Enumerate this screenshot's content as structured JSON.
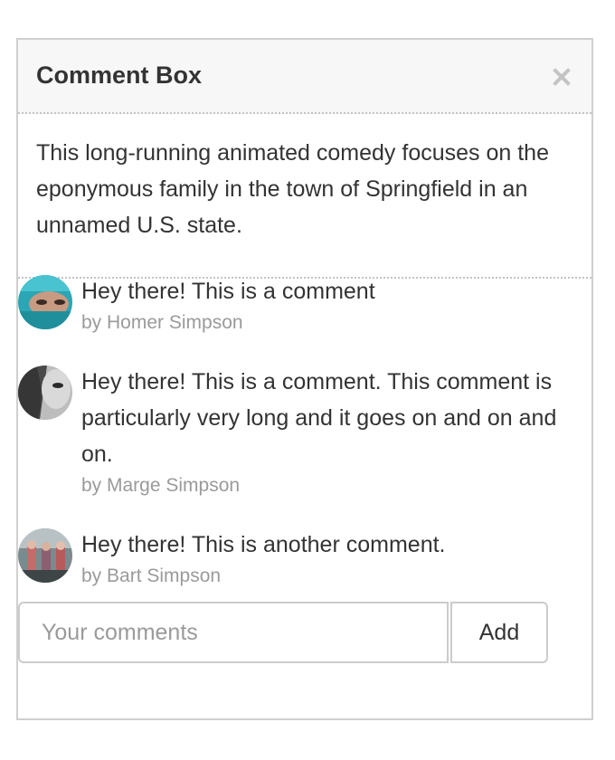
{
  "panel": {
    "title": "Comment Box",
    "close_icon": "close-icon",
    "description": "This long-running animated comedy focuses on the eponymous family in the town of Springfield in an unnamed U.S. state."
  },
  "comments": [
    {
      "text": "Hey there! This is a comment",
      "author": "by Homer Simpson",
      "avatar": "avatar-teal"
    },
    {
      "text": "Hey there! This is a comment. This comment is particularly very long and it goes on and on and on.",
      "author": "by Marge Simpson",
      "avatar": "avatar-grayscale"
    },
    {
      "text": "Hey there! This is another comment.",
      "author": "by Bart Simpson",
      "avatar": "avatar-group"
    }
  ],
  "form": {
    "placeholder": "Your comments",
    "value": "",
    "add_label": "Add"
  }
}
